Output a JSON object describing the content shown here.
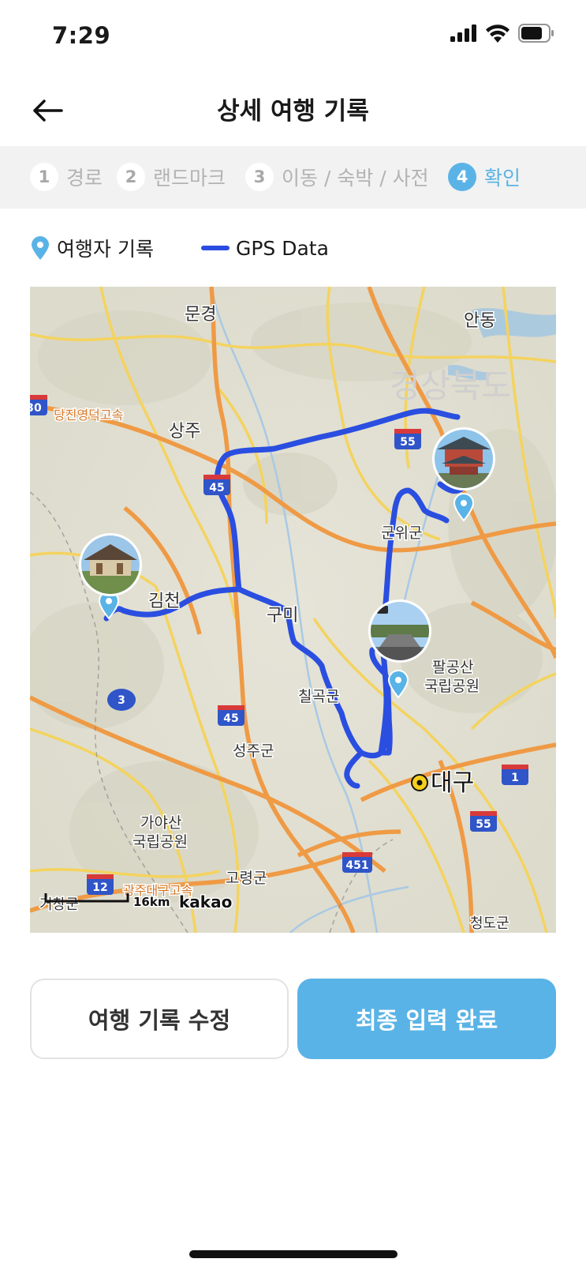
{
  "status_bar": {
    "time": "7:29"
  },
  "header": {
    "title": "상세 여행 기록"
  },
  "steps": [
    {
      "num": "1",
      "label": "경로",
      "active": false
    },
    {
      "num": "2",
      "label": "랜드마크",
      "active": false
    },
    {
      "num": "3",
      "label": "이동 / 숙박 / 사전",
      "active": false
    },
    {
      "num": "4",
      "label": "확인",
      "active": true
    }
  ],
  "legend": {
    "traveler_record": "여행자 기록",
    "gps_data": "GPS Data"
  },
  "colors": {
    "accent": "#5ab3e6",
    "gps_route": "#2a4ee0"
  },
  "map": {
    "labels": {
      "mungyeong": "문경",
      "andong": "안동",
      "gyeongbuk": "경상북도",
      "sangju": "상주",
      "gunwi": "군위군",
      "gimcheon": "김천",
      "gumi": "구미",
      "palgong1": "팔공산",
      "palgong2": "국립공원",
      "chilgok": "칠곡군",
      "seongju": "성주군",
      "daegu": "대구",
      "gaya1": "가야산",
      "gaya2": "국립공원",
      "goryeong": "고령군",
      "geochang": "거창군",
      "cheongdo": "청도군",
      "dangjin": "당진영덕고속",
      "gwangju": "광주대구고속"
    },
    "shields": {
      "s30": "30",
      "s55a": "55",
      "s45a": "45",
      "s3": "3",
      "s45b": "45",
      "s1": "1",
      "s55b": "55",
      "s451": "451",
      "s12": "12"
    },
    "scale": "16km",
    "provider": "kakao"
  },
  "buttons": {
    "edit": "여행 기록 수정",
    "done": "최종 입력 완료"
  }
}
